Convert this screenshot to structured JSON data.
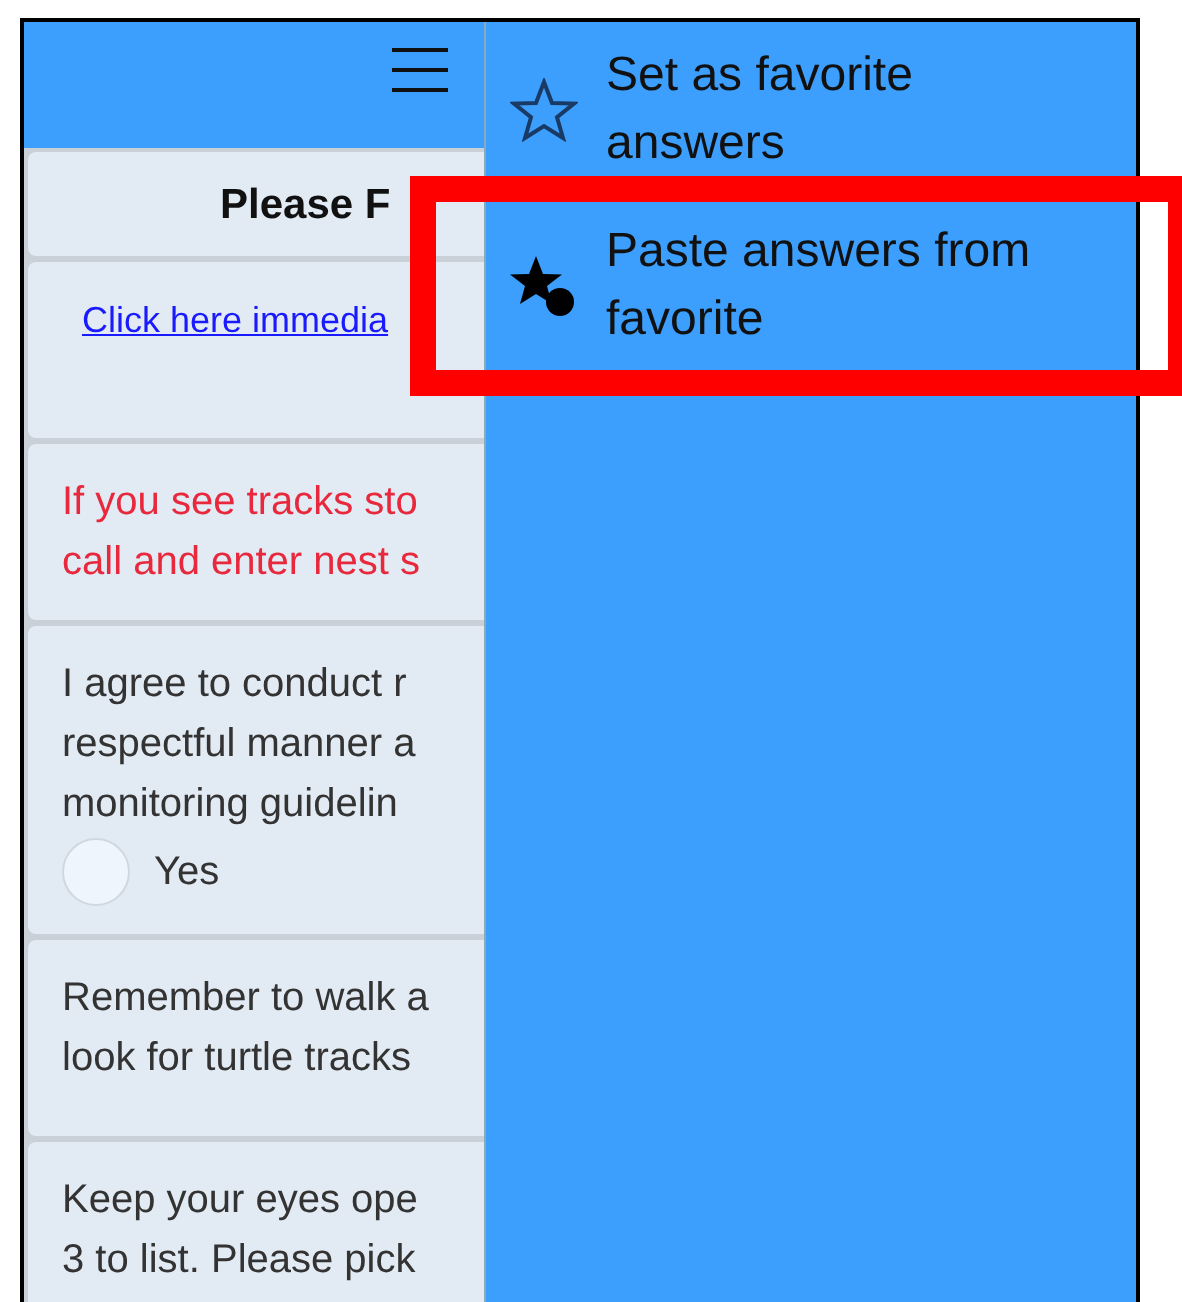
{
  "form": {
    "title": "Please F",
    "cards": [
      {
        "kind": "link",
        "lines": [
          "Click here immedia"
        ]
      },
      {
        "kind": "alert",
        "lines": [
          "If you see tracks sto",
          "call and enter nest s"
        ]
      },
      {
        "kind": "question",
        "lines": [
          "I agree to conduct r",
          "respectful manner a",
          "monitoring guidelin"
        ],
        "options": [
          {
            "label": "Yes",
            "selected": false
          }
        ]
      },
      {
        "kind": "note",
        "lines": [
          "Remember to walk a",
          "look for turtle tracks"
        ]
      },
      {
        "kind": "note",
        "lines": [
          "Keep your eyes ope",
          "3 to list. Please pick"
        ]
      }
    ]
  },
  "menu": {
    "items": [
      {
        "kind": "outline-star",
        "label": "Set as favorite answers",
        "highlighted": false
      },
      {
        "kind": "star-dot",
        "label": "Paste answers from favorite",
        "highlighted": true
      }
    ]
  }
}
